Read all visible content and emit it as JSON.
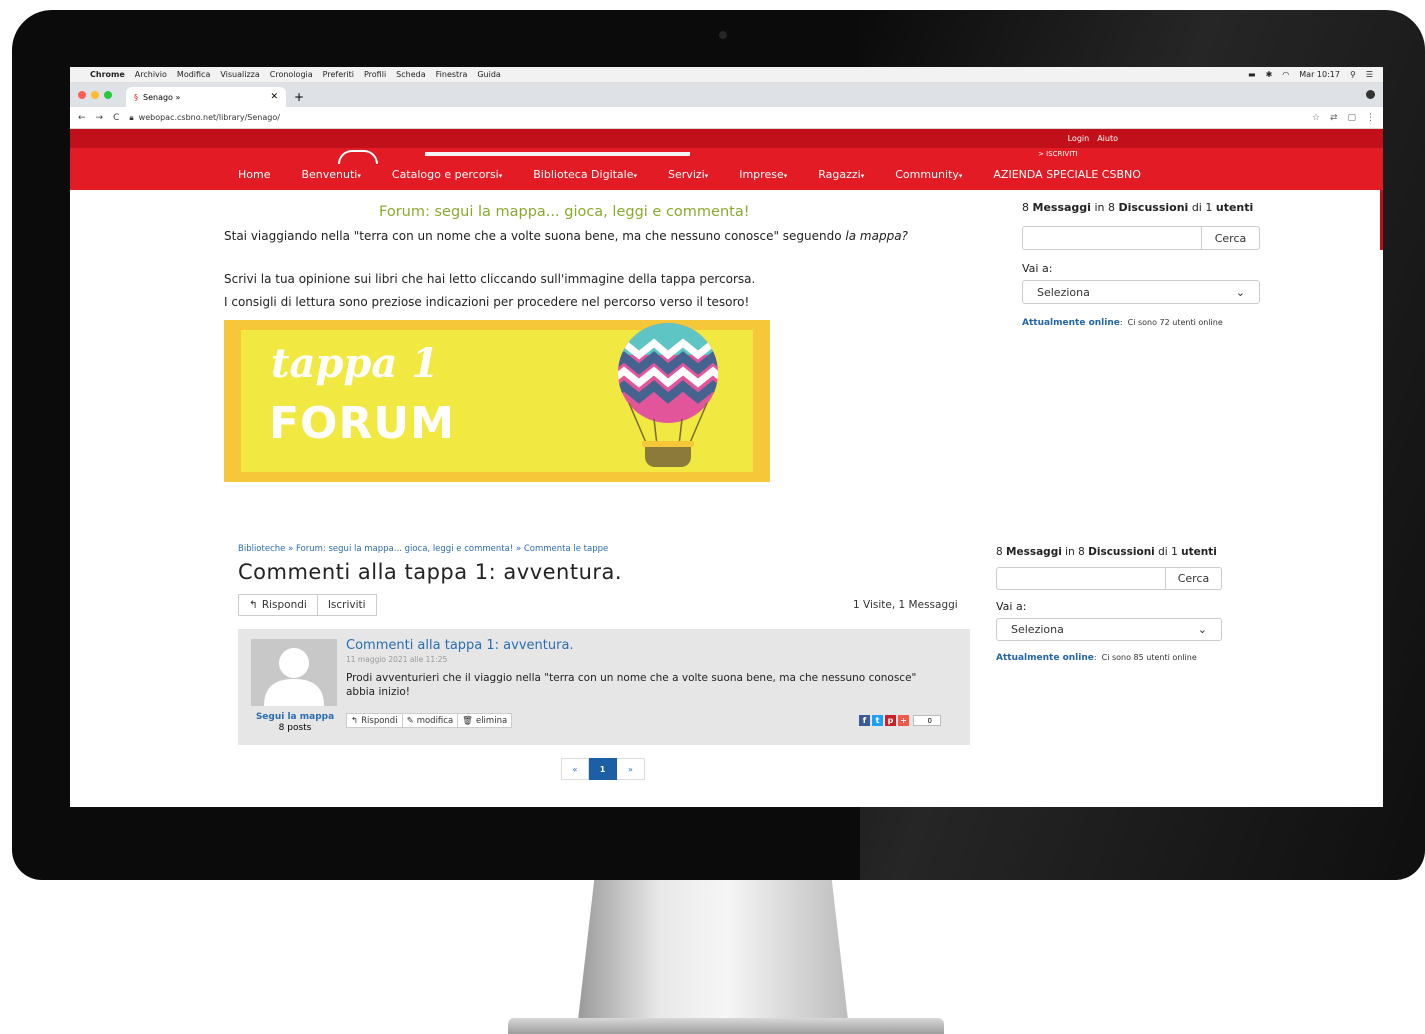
{
  "macos": {
    "apple": "",
    "app": "Chrome",
    "menu": [
      "Archivio",
      "Modifica",
      "Visualizza",
      "Cronologia",
      "Preferiti",
      "Profili",
      "Scheda",
      "Finestra",
      "Guida"
    ],
    "clock": "Mar 10:17"
  },
  "browser": {
    "tab_title": "Senago »",
    "url": "webopac.csbno.net/library/Senago/"
  },
  "site": {
    "top_links": [
      "Login",
      "Aiuto"
    ],
    "iscriviti": "> ISCRIVITI",
    "nav": [
      {
        "label": "Home",
        "caret": ""
      },
      {
        "label": "Benvenuti",
        "caret": "▾"
      },
      {
        "label": "Catalogo e percorsi",
        "caret": "▾"
      },
      {
        "label": "Biblioteca Digitale",
        "caret": "▾"
      },
      {
        "label": "Servizi",
        "caret": "▾"
      },
      {
        "label": "Imprese",
        "caret": "▾"
      },
      {
        "label": "Ragazzi",
        "caret": "▾"
      },
      {
        "label": "Community",
        "caret": "▾"
      },
      {
        "label": "AZIENDA SPECIALE CSBNO",
        "caret": ""
      }
    ]
  },
  "upper": {
    "heading": "Forum: segui la mappa... gioca, leggi e commenta!",
    "p1_text": "Stai viaggiando nella \"terra con un nome che a volte suona bene, ma che nessuno conosce\" seguendo ",
    "p1_italic": "la mappa?",
    "p2": "Scrivi la tua opinione sui libri che hai letto cliccando sull'immagine della tappa percorsa.",
    "p3": "I consigli di lettura sono preziose indicazioni per procedere nel percorso verso il tesoro!",
    "banner_line1": "tappa 1",
    "banner_line2": "FORUM"
  },
  "sidebar1": {
    "c1": "8",
    "l1": "Messaggi",
    "in": "in",
    "c2": "8",
    "l2": "Discussioni",
    "di": "di",
    "c3": "1",
    "l3": "utenti",
    "search_button": "Cerca",
    "vai_label": "Vai a:",
    "select_value": "Seleziona",
    "online_label": "Attualmente online",
    "online_text": "Ci sono 72 utenti online"
  },
  "sidebar2": {
    "c1": "8",
    "l1": "Messaggi",
    "in": "in",
    "c2": "8",
    "l2": "Discussioni",
    "di": "di",
    "c3": "1",
    "l3": "utenti",
    "search_button": "Cerca",
    "vai_label": "Vai a:",
    "select_value": "Seleziona",
    "online_label": "Attualmente online",
    "online_text": "Ci sono 85 utenti online"
  },
  "lower": {
    "crumbs": [
      "Biblioteche",
      "Forum: segui la mappa... gioca, leggi e commenta!",
      "Commenta le tappe"
    ],
    "crumb_sep": "»",
    "title": "Commenti alla tappa 1: avventura.",
    "reply_button": "Rispondi",
    "subscribe_button": "Iscriviti",
    "visits": "1 Visite, 1 Messaggi"
  },
  "post": {
    "title": "Commenti alla tappa 1: avventura.",
    "date": "11 maggio 2021 alle 11:25",
    "text": "Prodi avventurieri che il viaggio nella \"terra con un nome che a volte suona bene, ma che nessuno conosce\" abbia inizio!",
    "author": "Segui la mappa",
    "author_posts": "8 posts",
    "actions": [
      "Rispondi",
      "modifica",
      "elimina"
    ],
    "share_icons": [
      "f",
      "t",
      "p",
      "+"
    ],
    "share_count": "0"
  },
  "pager": {
    "prev": "«",
    "current": "1",
    "next": "»"
  },
  "colors": {
    "brand_red": "#e21b24",
    "link_blue": "#2a6db0",
    "heading_green": "#8aaa2e"
  }
}
